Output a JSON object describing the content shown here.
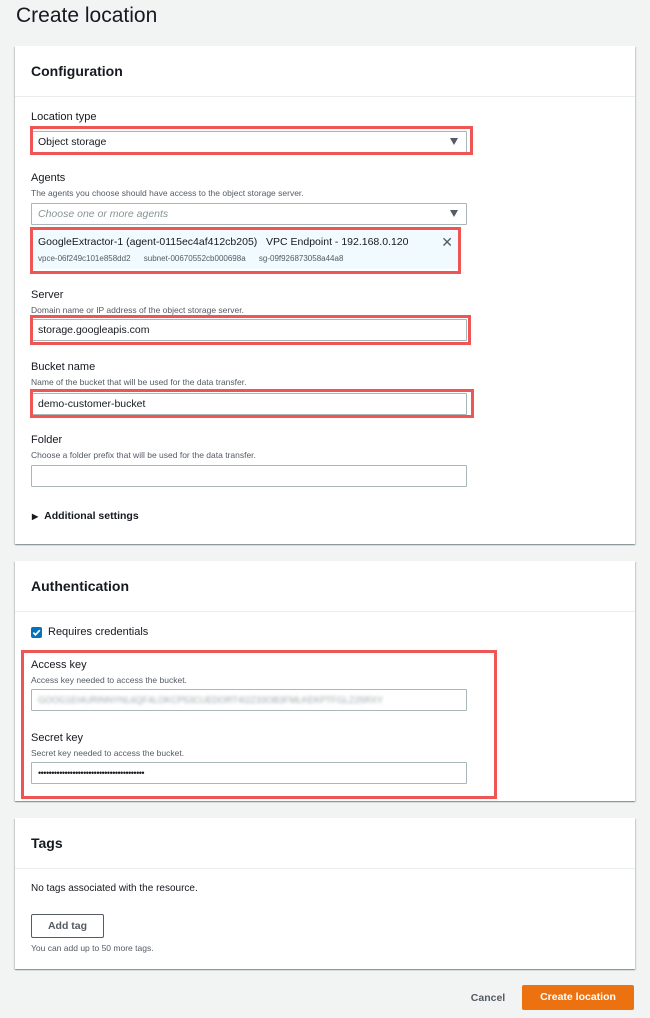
{
  "page": {
    "title": "Create location"
  },
  "configuration": {
    "header": "Configuration",
    "location_type": {
      "label": "Location type",
      "value": "Object storage"
    },
    "agents": {
      "label": "Agents",
      "description": "The agents you choose should have access to the object storage server.",
      "placeholder": "Choose one or more agents",
      "selected": {
        "title": "GoogleExtractor-1 (agent-0115ec4af412cb205)   VPC Endpoint - 192.168.0.120",
        "vpce": "vpce-06f249c101e858dd2",
        "subnet": "subnet-00670552cb000698a",
        "sg": "sg-09f926873058a44a8"
      }
    },
    "server": {
      "label": "Server",
      "description": "Domain name or IP address of the object storage server.",
      "value": "storage.googleapis.com"
    },
    "bucket": {
      "label": "Bucket name",
      "description": "Name of the bucket that will be used for the data transfer.",
      "value": "demo-customer-bucket"
    },
    "folder": {
      "label": "Folder",
      "description": "Choose a folder prefix that will be used for the data transfer.",
      "value": ""
    },
    "additional_settings": "Additional settings"
  },
  "authentication": {
    "header": "Authentication",
    "requires_credentials": "Requires credentials",
    "access_key": {
      "label": "Access key",
      "description": "Access key needed to access the bucket.",
      "value": "GOOG1EI4URINNYNL6QF4LOKCP53CUEDORT4I2Z33OB3FMLKEKPTFGLZ25RXY"
    },
    "secret_key": {
      "label": "Secret key",
      "description": "Secret key needed to access the bucket.",
      "value": "••••••••••••••••••••••••••••••••••••••••"
    }
  },
  "tags": {
    "header": "Tags",
    "empty_message": "No tags associated with the resource.",
    "add_button": "Add tag",
    "limit_note": "You can add up to 50 more tags."
  },
  "footer": {
    "cancel": "Cancel",
    "create": "Create location"
  },
  "colors": {
    "primary": "#ec7211",
    "highlight": "#ee5555",
    "link": "#0073bb"
  }
}
